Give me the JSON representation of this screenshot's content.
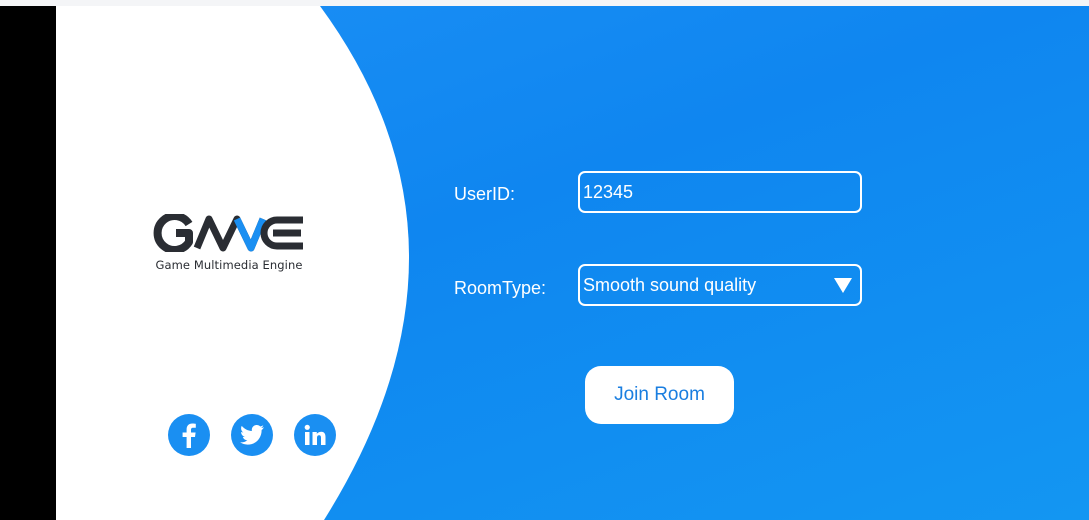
{
  "brand": {
    "logo_text": "GME",
    "tagline": "Game Multimedia Engine",
    "colors": {
      "dark": "#2a2d33",
      "accent": "#1a8ff2"
    }
  },
  "social": [
    {
      "name": "facebook",
      "icon": "facebook-icon"
    },
    {
      "name": "twitter",
      "icon": "twitter-icon"
    },
    {
      "name": "linkedin",
      "icon": "linkedin-icon"
    }
  ],
  "form": {
    "user_id": {
      "label": "UserID:",
      "value": "12345"
    },
    "room_type": {
      "label": "RoomType:",
      "selected": "Smooth sound quality"
    },
    "join_label": "Join Room"
  },
  "colors": {
    "background": "#0f86f0",
    "button_text": "#1a7ee0"
  }
}
